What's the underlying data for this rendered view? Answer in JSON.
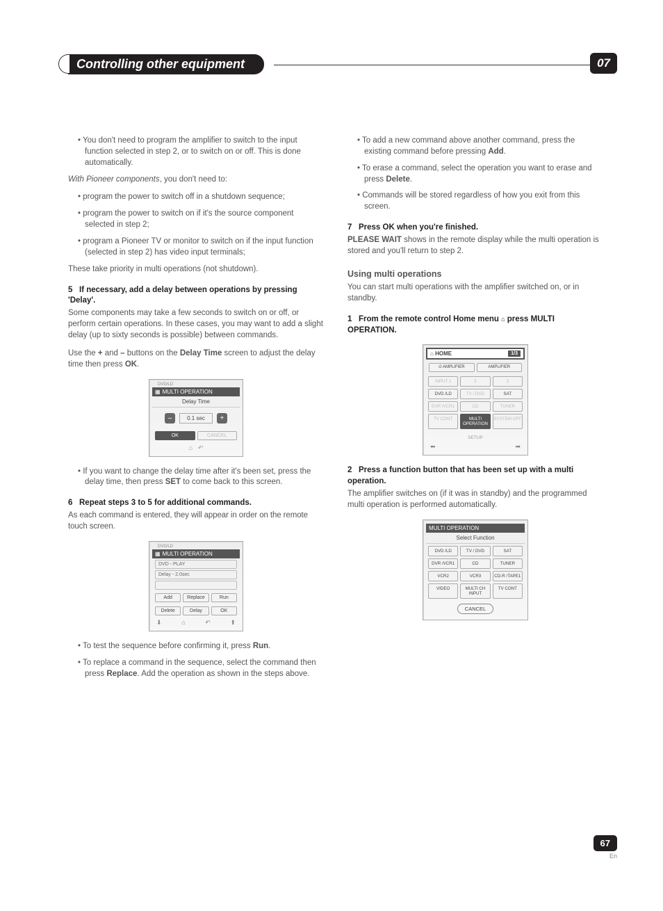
{
  "header": {
    "title": "Controlling other equipment",
    "chapter": "07"
  },
  "left": {
    "bullets1": [
      "You don't need to program the amplifier to switch to the input function selected in step 2, or to switch on or off. This is done automatically."
    ],
    "with_pioneer_intro": "With Pioneer components",
    "with_pioneer_suffix": ", you don't need to:",
    "bullets2": [
      "program the power to switch off in a shutdown sequence;",
      "program the power to switch on if it's the source component selected in step 2;",
      "program a Pioneer TV or monitor to switch on if the input function (selected in step 2) has video input terminals;"
    ],
    "priority_line": "These take priority in multi operations (not shutdown).",
    "step5_label": "5",
    "step5_title": "If necessary, add a delay between operations by pressing 'Delay'.",
    "step5_body": "Some components may take a few seconds to switch on or off, or perform certain operations. In these cases, you may want to add a slight delay (up to sixty seconds is possible) between commands.",
    "delay_instr_pre": "Use the ",
    "delay_instr_plus": "+",
    "delay_instr_mid1": " and ",
    "delay_instr_minus": "–",
    "delay_instr_mid2": " buttons on the ",
    "delay_instr_screen": "Delay Time",
    "delay_instr_mid3": " screen to adjust the delay time then press ",
    "delay_instr_ok": "OK",
    "delay_instr_end": ".",
    "mock1": {
      "tag": "DVD/LD",
      "title": "MULTI OPERATION",
      "sub": "Delay Time",
      "minus": "–",
      "value": "0.1 sec",
      "plus": "+",
      "ok": "OK",
      "cancel": "CANCEL"
    },
    "bullet_change_pre": "If you want to change the delay time after it's been set, press the delay time, then press ",
    "bullet_change_set": "SET",
    "bullet_change_post": " to come back to this screen.",
    "step6_label": "6",
    "step6_title": "Repeat steps 3 to 5 for additional commands.",
    "step6_body": "As each command is entered, they will appear in order on the remote touch screen.",
    "mock2": {
      "tag": "DVD/LD",
      "title": "MULTI OPERATION",
      "line1": "DVD - PLAY",
      "line2": "Delay -   2.0sec",
      "add": "Add",
      "replace": "Replace",
      "run": "Run",
      "delete": "Delete",
      "delay": "Delay",
      "ok": "OK"
    },
    "bullet_run_pre": "To test the sequence before confirming it, press ",
    "bullet_run_bold": "Run",
    "bullet_run_post": ".",
    "bullet_replace_pre": "To replace a command in the sequence, select the command then press ",
    "bullet_replace_bold": "Replace",
    "bullet_replace_post": ". Add the operation as shown in the steps above."
  },
  "right": {
    "bullet_add_pre": "To add a new command above another command, press the existing command before pressing ",
    "bullet_add_bold": "Add",
    "bullet_add_post": ".",
    "bullet_erase_pre": "To erase a command, select the operation you want to erase and press ",
    "bullet_erase_bold": "Delete",
    "bullet_erase_post": ".",
    "bullet_stored": "Commands will be stored regardless of how you exit from this screen.",
    "step7_label": "7",
    "step7_title": "Press OK when you're finished.",
    "step7_body_pre": "PLEASE WAIT",
    "step7_body_post": " shows in the remote display while the multi operation is stored and you'll return to step 2.",
    "using_h": "Using multi operations",
    "using_body": "You can start multi operations with the amplifier switched on, or in standby.",
    "step1_label": "1",
    "step1_title_pre": "From the remote control Home menu ",
    "step1_title_post": " press MULTI OPERATION.",
    "mock3": {
      "home": "HOME",
      "page": "1/3",
      "row1": [
        "⏻ AMPLIFIER",
        "AMPLIFIER"
      ],
      "row2": [
        "INPUT 1",
        "2",
        "3"
      ],
      "row3": [
        "DVD /LD",
        "TV / DVD",
        "SAT"
      ],
      "row4": [
        "DVR /VCR1",
        "CD",
        "TUNER"
      ],
      "row5": [
        "TV CONT",
        "MULTI OPERATION",
        "SYSTEM OFF"
      ],
      "setup": "SETUP"
    },
    "step2_label": "2",
    "step2_title": "Press a function button that has been set up with a multi operation.",
    "step2_body": "The amplifier switches on (if it was in standby) and the programmed multi operation is performed automatically.",
    "mock4": {
      "title": "MULTI OPERATION",
      "sub": "Select Function",
      "grid": [
        "DVD /LD",
        "TV / DVD",
        "SAT",
        "DVR /VCR1",
        "CD",
        "TUNER",
        "VCR2",
        "VCR3",
        "CD-R /TAPE1",
        "VIDEO",
        "MULTI CH INPUT",
        "TV CONT"
      ],
      "cancel": "CANCEL"
    }
  },
  "footer": {
    "page": "67",
    "lang": "En"
  }
}
